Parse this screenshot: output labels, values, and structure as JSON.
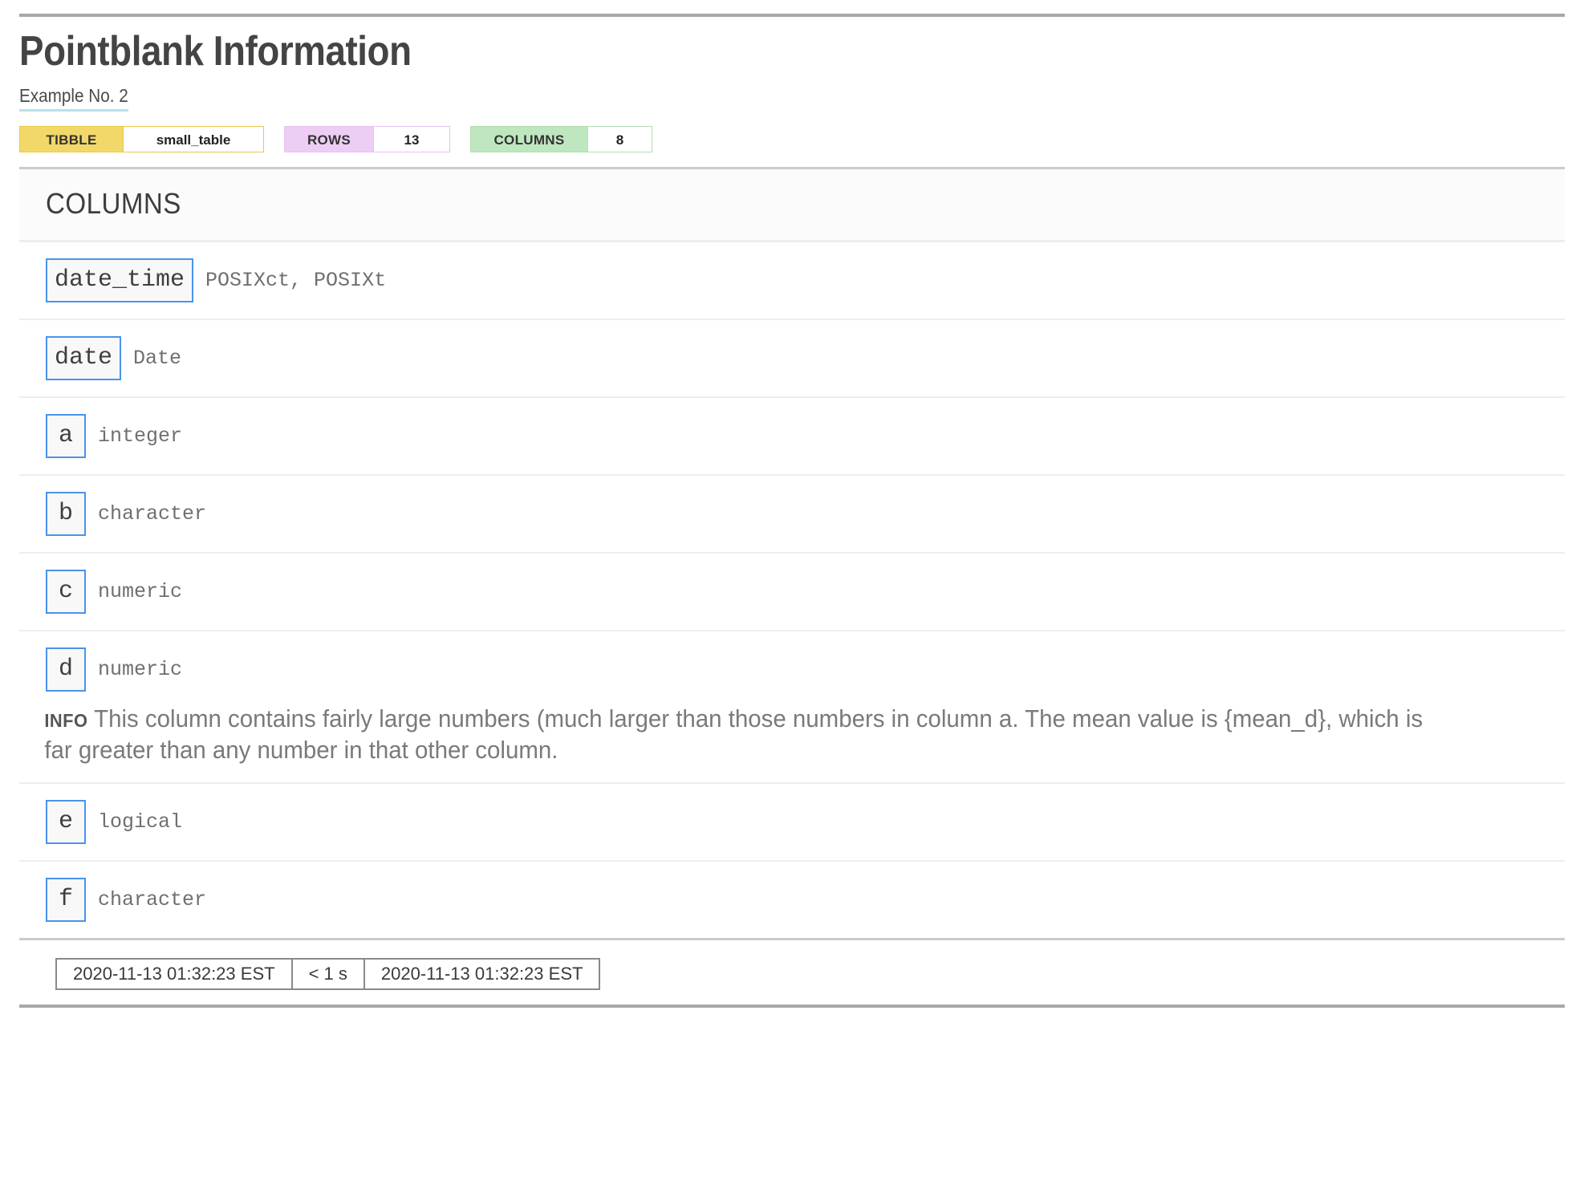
{
  "report": {
    "title": "Pointblank Information",
    "subtitle": "Example No. 2"
  },
  "badges": [
    {
      "key": "TIBBLE",
      "value": "small_table",
      "bg": "#f2d868",
      "border": "#e9c94a"
    },
    {
      "key": "ROWS",
      "value": "13",
      "bg": "#eecdf5",
      "border": "#e6c2f0"
    },
    {
      "key": "COLUMNS",
      "value": "8",
      "bg": "#bfe7bf",
      "border": "#b5ddb5"
    }
  ],
  "section": {
    "heading": "COLUMNS"
  },
  "columns": [
    {
      "name": "date_time",
      "type": "POSIXct, POSIXt",
      "info": null,
      "info_tag": null
    },
    {
      "name": "date",
      "type": "Date",
      "info": null,
      "info_tag": null
    },
    {
      "name": "a",
      "type": "integer",
      "info": null,
      "info_tag": null
    },
    {
      "name": "b",
      "type": "character",
      "info": null,
      "info_tag": null
    },
    {
      "name": "c",
      "type": "numeric",
      "info": null,
      "info_tag": null
    },
    {
      "name": "d",
      "type": "numeric",
      "info_tag": "INFO",
      "info": "This column contains fairly large numbers (much larger than those numbers in column a. The mean value is {mean_d}, which is far greater than any number in that other column."
    },
    {
      "name": "e",
      "type": "logical",
      "info": null,
      "info_tag": null
    },
    {
      "name": "f",
      "type": "character",
      "info": null,
      "info_tag": null
    }
  ],
  "footer": {
    "start_time": "2020-11-13 01:32:23 EST",
    "duration": "< 1 s",
    "end_time": "2020-11-13 01:32:23 EST"
  },
  "colors": {
    "rule": "#a8a8a8",
    "row_divider": "#ededed",
    "column_box_border": "#4a93ec",
    "subtitle_underline": "#b9e0ea"
  }
}
